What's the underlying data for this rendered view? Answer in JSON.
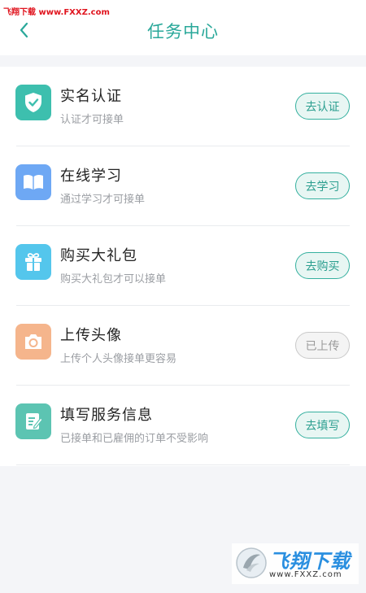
{
  "watermark_top": "飞翔下载 www.FXXZ.com",
  "header": {
    "title": "任务中心"
  },
  "tasks": [
    {
      "title": "实名认证",
      "subtitle": "认证才可接单",
      "action": "去认证",
      "icon": "shield-check-icon",
      "color": "#3dbfae",
      "done": false
    },
    {
      "title": "在线学习",
      "subtitle": "通过学习才可接单",
      "action": "去学习",
      "icon": "book-icon",
      "color": "#6ea8f4",
      "done": false
    },
    {
      "title": "购买大礼包",
      "subtitle": "购买大礼包才可以接单",
      "action": "去购买",
      "icon": "gift-icon",
      "color": "#54c6ec",
      "done": false
    },
    {
      "title": "上传头像",
      "subtitle": "上传个人头像接单更容易",
      "action": "已上传",
      "icon": "camera-icon",
      "color": "#f5b58c",
      "done": true
    },
    {
      "title": "填写服务信息",
      "subtitle": "已接单和已雇佣的订单不受影响",
      "action": "去填写",
      "icon": "edit-document-icon",
      "color": "#5cc4b2",
      "done": false
    }
  ],
  "watermark_logo": {
    "brand": "飞翔下载",
    "url": "www.FXXZ.com"
  }
}
